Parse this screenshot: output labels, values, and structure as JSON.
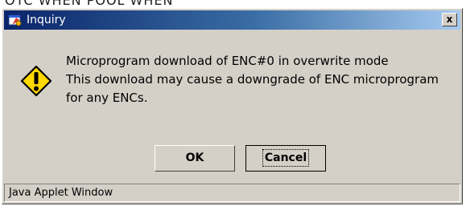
{
  "top_sliver_text": "OTC WHEN POOL WHEN",
  "window": {
    "title": "Inquiry",
    "close_label": "x"
  },
  "message": {
    "lines": [
      "Microprogram download of ENC#0 in overwrite mode",
      "This download may cause a downgrade of ENC microprogram",
      "for any ENCs."
    ]
  },
  "buttons": {
    "ok": "OK",
    "cancel": "Cancel"
  },
  "status_bar": {
    "text": "Java Applet Window"
  },
  "colors": {
    "window_bg": "#d4d0c8",
    "titlebar_start": "#0a246a",
    "titlebar_end": "#a6caf0",
    "warning_fill": "#ffd800"
  },
  "icons": {
    "title": "java-app-icon",
    "message": "warning-icon"
  }
}
